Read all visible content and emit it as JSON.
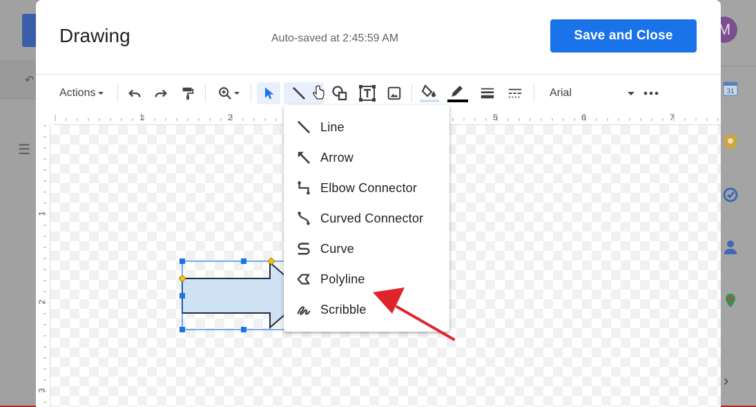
{
  "dialog": {
    "title": "Drawing",
    "autosave": "Auto-saved at 2:45:59 AM",
    "save_label": "Save and Close"
  },
  "toolbar": {
    "actions_label": "Actions",
    "font_name": "Arial"
  },
  "ruler": {
    "top_numbers": [
      "1",
      "2",
      "5",
      "6",
      "7"
    ],
    "left_numbers": [
      "1",
      "2",
      "3"
    ]
  },
  "line_menu": {
    "items": [
      {
        "label": "Line",
        "icon": "line-icon"
      },
      {
        "label": "Arrow",
        "icon": "arrow-icon"
      },
      {
        "label": "Elbow Connector",
        "icon": "elbow-connector-icon"
      },
      {
        "label": "Curved Connector",
        "icon": "curved-connector-icon"
      },
      {
        "label": "Curve",
        "icon": "curve-icon"
      },
      {
        "label": "Polyline",
        "icon": "polyline-icon"
      },
      {
        "label": "Scribble",
        "icon": "scribble-icon"
      }
    ]
  },
  "background": {
    "avatar_letter": "M",
    "calendar_day": "31"
  },
  "colors": {
    "accent": "#1a73e8",
    "shape_fill": "#cfe2f3",
    "annotation_arrow": "#e0252a",
    "handle_blue": "#1a73e8",
    "handle_yellow": "#f9c30f"
  }
}
